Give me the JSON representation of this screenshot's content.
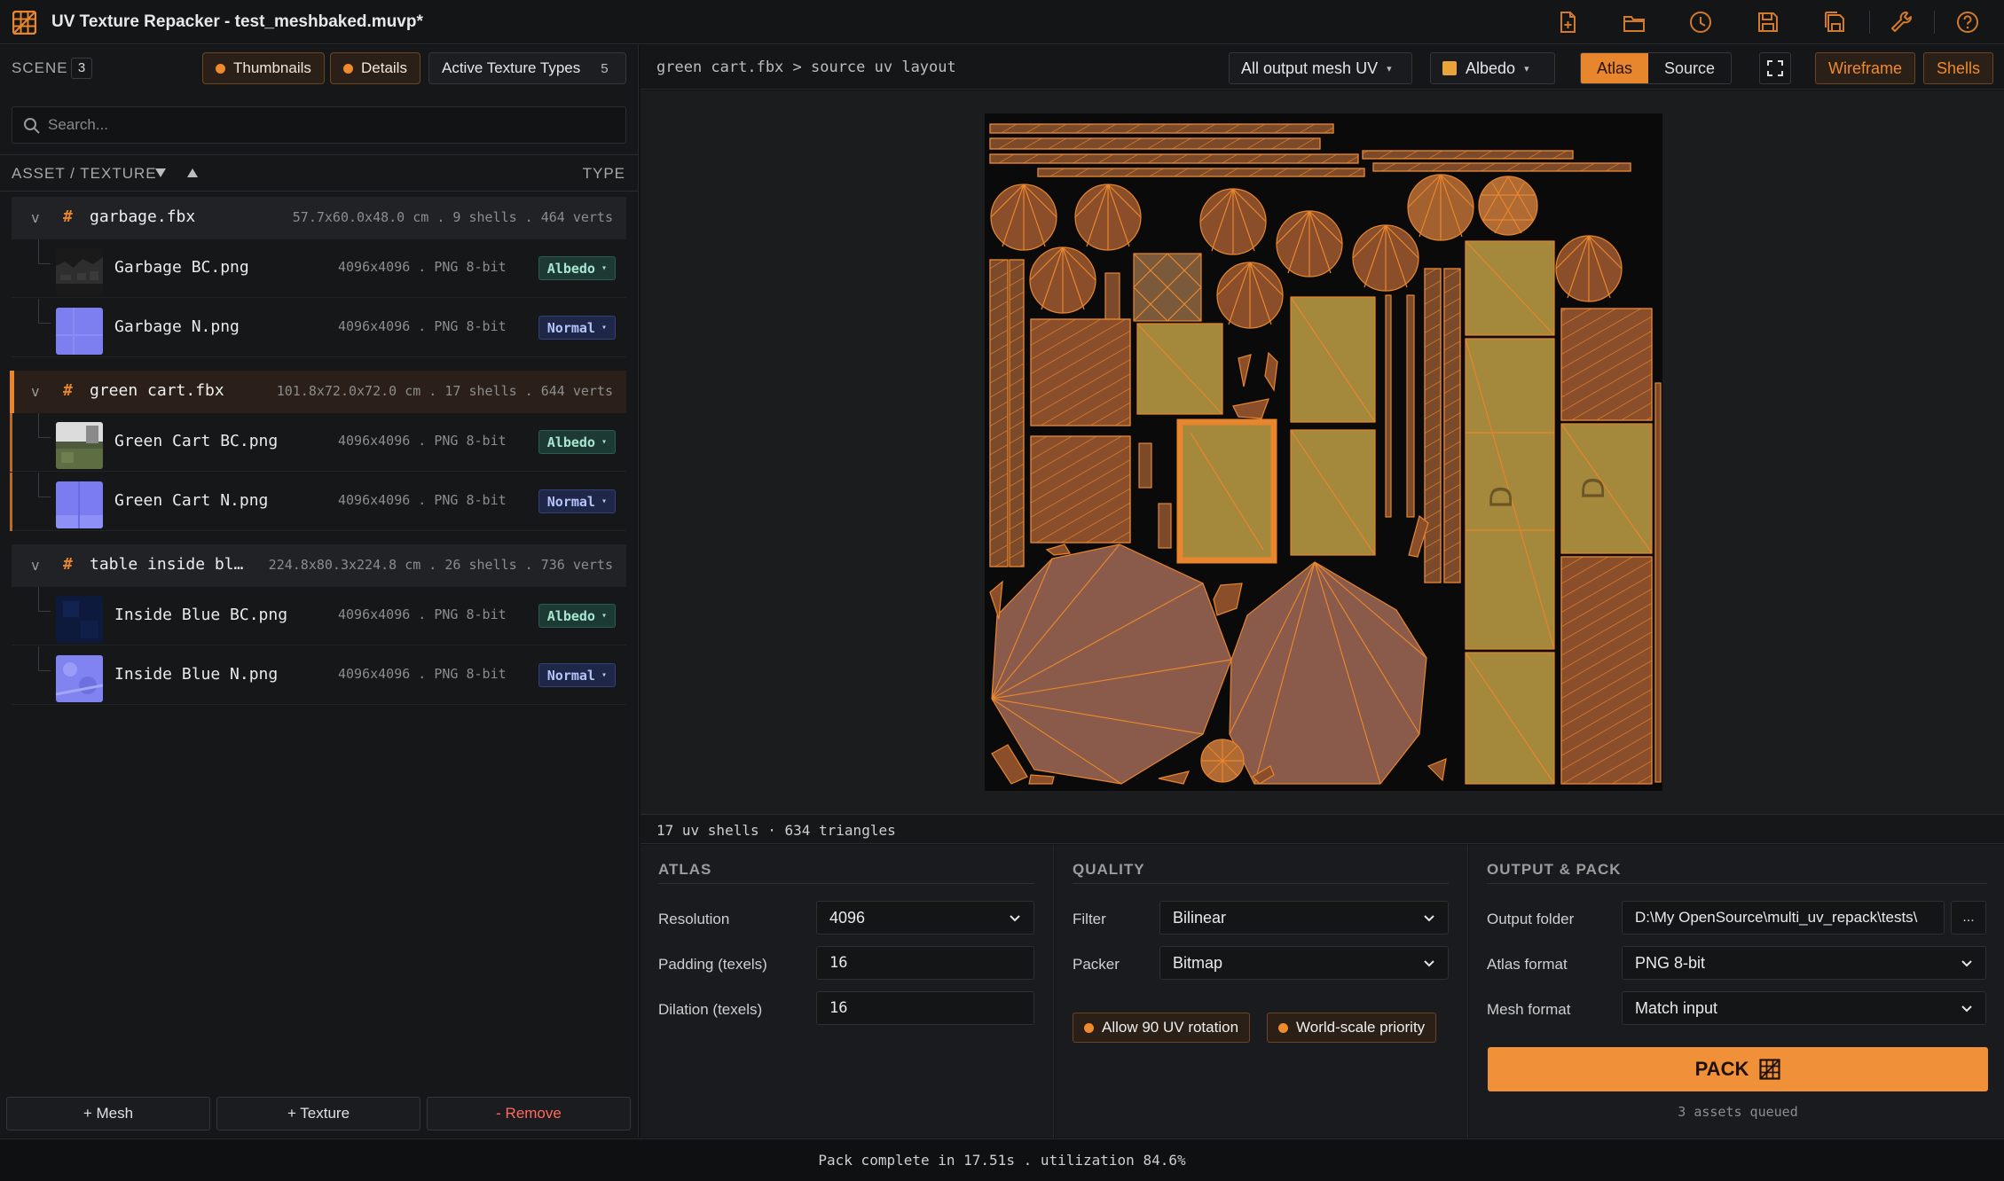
{
  "window": {
    "title": "UV Texture Repacker - test_meshbaked.muvp*"
  },
  "toolbar_icons": [
    "new-file-icon",
    "open-folder-icon",
    "history-icon",
    "save-icon",
    "save-as-icon",
    "wrench-icon",
    "help-icon"
  ],
  "left": {
    "scene_label": "SCENE",
    "scene_count": "3",
    "thumbnails_label": "Thumbnails",
    "details_label": "Details",
    "active_types_label": "Active Texture Types",
    "active_types_count": "5",
    "search_placeholder": "Search...",
    "col_asset": "ASSET / TEXTURE",
    "col_type": "TYPE",
    "groups": [
      {
        "chevron": "v",
        "hash": "#",
        "name": "garbage.fbx",
        "meta": "57.7x60.0x48.0 cm . 9 shells . 464 verts",
        "textures": [
          {
            "name": "Garbage BC.png",
            "meta": "4096x4096 . PNG 8-bit",
            "type": "Albedo"
          },
          {
            "name": "Garbage N.png",
            "meta": "4096x4096 . PNG 8-bit",
            "type": "Normal"
          }
        ]
      },
      {
        "chevron": "v",
        "hash": "#",
        "name": "green cart.fbx",
        "meta": "101.8x72.0x72.0 cm . 17 shells . 644 verts",
        "textures": [
          {
            "name": "Green Cart BC.png",
            "meta": "4096x4096 . PNG 8-bit",
            "type": "Albedo"
          },
          {
            "name": "Green Cart N.png",
            "meta": "4096x4096 . PNG 8-bit",
            "type": "Normal"
          }
        ]
      },
      {
        "chevron": "v",
        "hash": "#",
        "name": "table inside bl…",
        "meta": "224.8x80.3x224.8 cm . 26 shells . 736 verts",
        "textures": [
          {
            "name": "Inside Blue BC.png",
            "meta": "4096x4096 . PNG 8-bit",
            "type": "Albedo"
          },
          {
            "name": "Inside Blue N.png",
            "meta": "4096x4096 . PNG 8-bit",
            "type": "Normal"
          }
        ]
      }
    ],
    "buttons": {
      "add_mesh": "+ Mesh",
      "add_texture": "+ Texture",
      "remove": "- Remove"
    }
  },
  "viewer": {
    "breadcrumb": "green cart.fbx > source uv layout",
    "mesh_filter": "All output mesh UV",
    "channel": "Albedo",
    "view_atlas": "Atlas",
    "view_source": "Source",
    "wireframe": "Wireframe",
    "shells": "Shells",
    "stats": "17 uv shells · 634 triangles"
  },
  "atlas": {
    "title": "ATLAS",
    "resolution_label": "Resolution",
    "resolution": "4096",
    "padding_label": "Padding (texels)",
    "padding": "16",
    "dilation_label": "Dilation (texels)",
    "dilation": "16"
  },
  "quality": {
    "title": "QUALITY",
    "filter_label": "Filter",
    "filter": "Bilinear",
    "packer_label": "Packer",
    "packer": "Bitmap",
    "opt_rotation": "Allow 90 UV rotation",
    "opt_world_scale": "World-scale priority"
  },
  "output": {
    "title": "OUTPUT & PACK",
    "folder_label": "Output folder",
    "folder": "D:\\My OpenSource\\multi_uv_repack\\tests\\",
    "browse": "...",
    "atlas_format_label": "Atlas format",
    "atlas_format": "PNG 8-bit",
    "mesh_format_label": "Mesh format",
    "mesh_format": "Match input",
    "pack_label": "PACK",
    "queued": "3 assets queued"
  },
  "status": "Pack complete in 17.51s . utilization 84.6%",
  "colors": {
    "accent": "#e8862d",
    "albedo_badge": "#1c3a33",
    "normal_badge": "#1f2748",
    "danger": "#ff6b5a"
  }
}
